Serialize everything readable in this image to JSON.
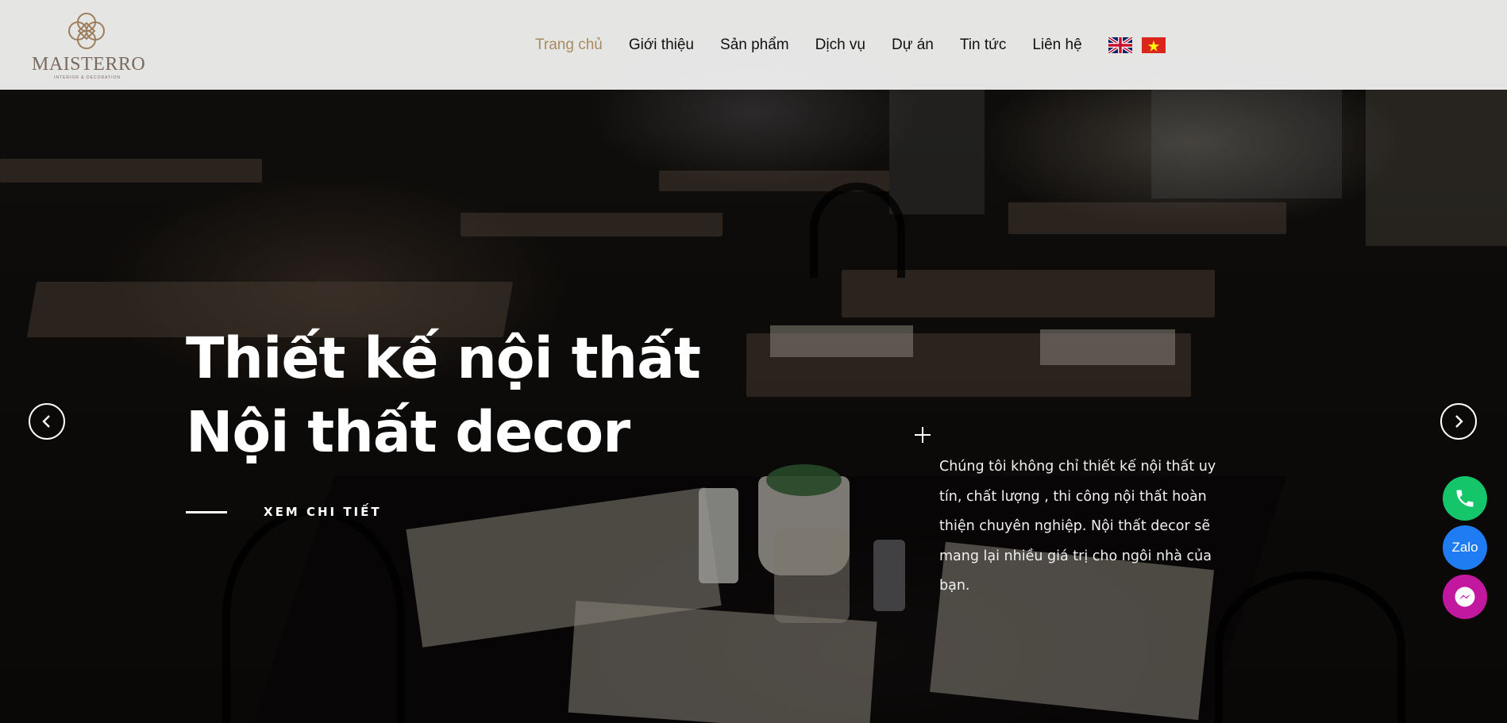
{
  "brand": {
    "name": "MAISTERRO",
    "tagline": "INTERIOR & DECORATION",
    "logo_color": "#7a6a5e"
  },
  "nav": {
    "items": [
      {
        "label": "Trang chủ",
        "active": true
      },
      {
        "label": "Giới thiệu",
        "active": false
      },
      {
        "label": "Sản phẩm",
        "active": false
      },
      {
        "label": "Dịch vụ",
        "active": false
      },
      {
        "label": "Dự án",
        "active": false
      },
      {
        "label": "Tin tức",
        "active": false
      },
      {
        "label": "Liên hệ",
        "active": false
      }
    ],
    "active_color": "#a98b62",
    "languages": [
      {
        "icon": "uk-flag-icon",
        "code": "en"
      },
      {
        "icon": "vietnam-flag-icon",
        "code": "vi"
      }
    ]
  },
  "hero": {
    "title_line1": "Thiết kế nội thất",
    "title_line2": "Nội thất decor",
    "cta_label": "XEM CHI TIẾT",
    "description": "Chúng tôi không chỉ thiết kế nội thất uy tín, chất lượng , thi công nội thất hoàn thiện chuyên nghiệp. Nội thất decor sẽ mang lại nhiều giá trị cho ngôi nhà của bạn."
  },
  "slider": {
    "prev_icon": "chevron-left-icon",
    "next_icon": "chevron-right-icon"
  },
  "contact_buttons": {
    "phone": {
      "icon": "phone-icon",
      "color": "#15c569"
    },
    "zalo": {
      "label": "Zalo",
      "color": "#1f7cf2"
    },
    "messenger": {
      "icon": "messenger-icon",
      "color": "#c218a0"
    }
  }
}
